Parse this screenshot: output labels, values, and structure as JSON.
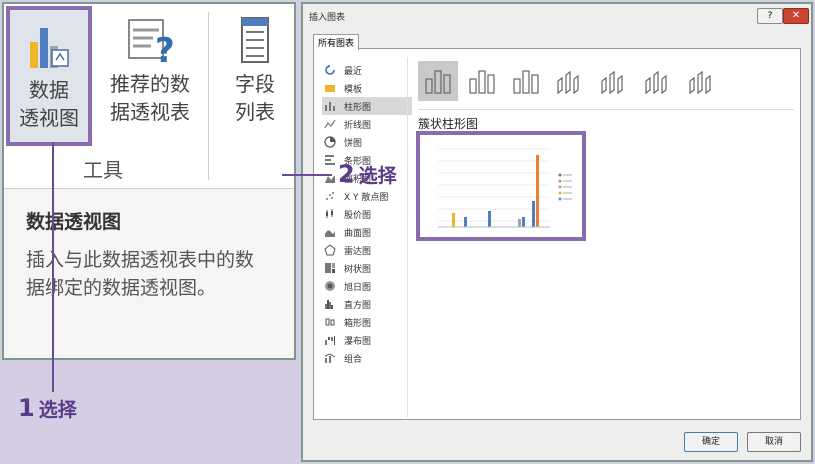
{
  "ribbon": {
    "pivot_chart": {
      "line1": "数据",
      "line2": "透视图"
    },
    "recommended_pivot": {
      "line1": "推荐的数",
      "line2": "据透视表"
    },
    "field_list": {
      "line1": "字段",
      "line2": "列表"
    },
    "group_label": "工具",
    "tooltip": {
      "title": "数据透视图",
      "body": "插入与此数据透视表中的数据绑定的数据透视图。"
    }
  },
  "callouts": {
    "step1": {
      "num": "1",
      "text": "选择"
    },
    "step2": {
      "num": "2",
      "text": "选择"
    }
  },
  "dialog": {
    "title": "插入图表",
    "help": "?",
    "close": "✕",
    "tab": "所有图表",
    "chart_types": [
      {
        "label": "最近",
        "icon": "recent-icon"
      },
      {
        "label": "模板",
        "icon": "folder-icon"
      },
      {
        "label": "柱形图",
        "icon": "column-chart-icon",
        "selected": true
      },
      {
        "label": "折线图",
        "icon": "line-chart-icon"
      },
      {
        "label": "饼图",
        "icon": "pie-chart-icon"
      },
      {
        "label": "条形图",
        "icon": "bar-chart-icon"
      },
      {
        "label": "面积图",
        "icon": "area-chart-icon"
      },
      {
        "label": "X Y 散点图",
        "icon": "scatter-chart-icon"
      },
      {
        "label": "股价图",
        "icon": "stock-chart-icon"
      },
      {
        "label": "曲面图",
        "icon": "surface-chart-icon"
      },
      {
        "label": "雷达图",
        "icon": "radar-chart-icon"
      },
      {
        "label": "树状图",
        "icon": "treemap-chart-icon"
      },
      {
        "label": "旭日图",
        "icon": "sunburst-chart-icon"
      },
      {
        "label": "直方图",
        "icon": "histogram-chart-icon"
      },
      {
        "label": "箱形图",
        "icon": "boxwhisker-chart-icon"
      },
      {
        "label": "瀑布图",
        "icon": "waterfall-chart-icon"
      },
      {
        "label": "组合",
        "icon": "combo-chart-icon"
      }
    ],
    "subtype_title": "簇状柱形图",
    "ok": "确定",
    "cancel": "取消",
    "colors": {
      "accent": "#8a6bb0",
      "callout": "#5a3a8a"
    }
  }
}
